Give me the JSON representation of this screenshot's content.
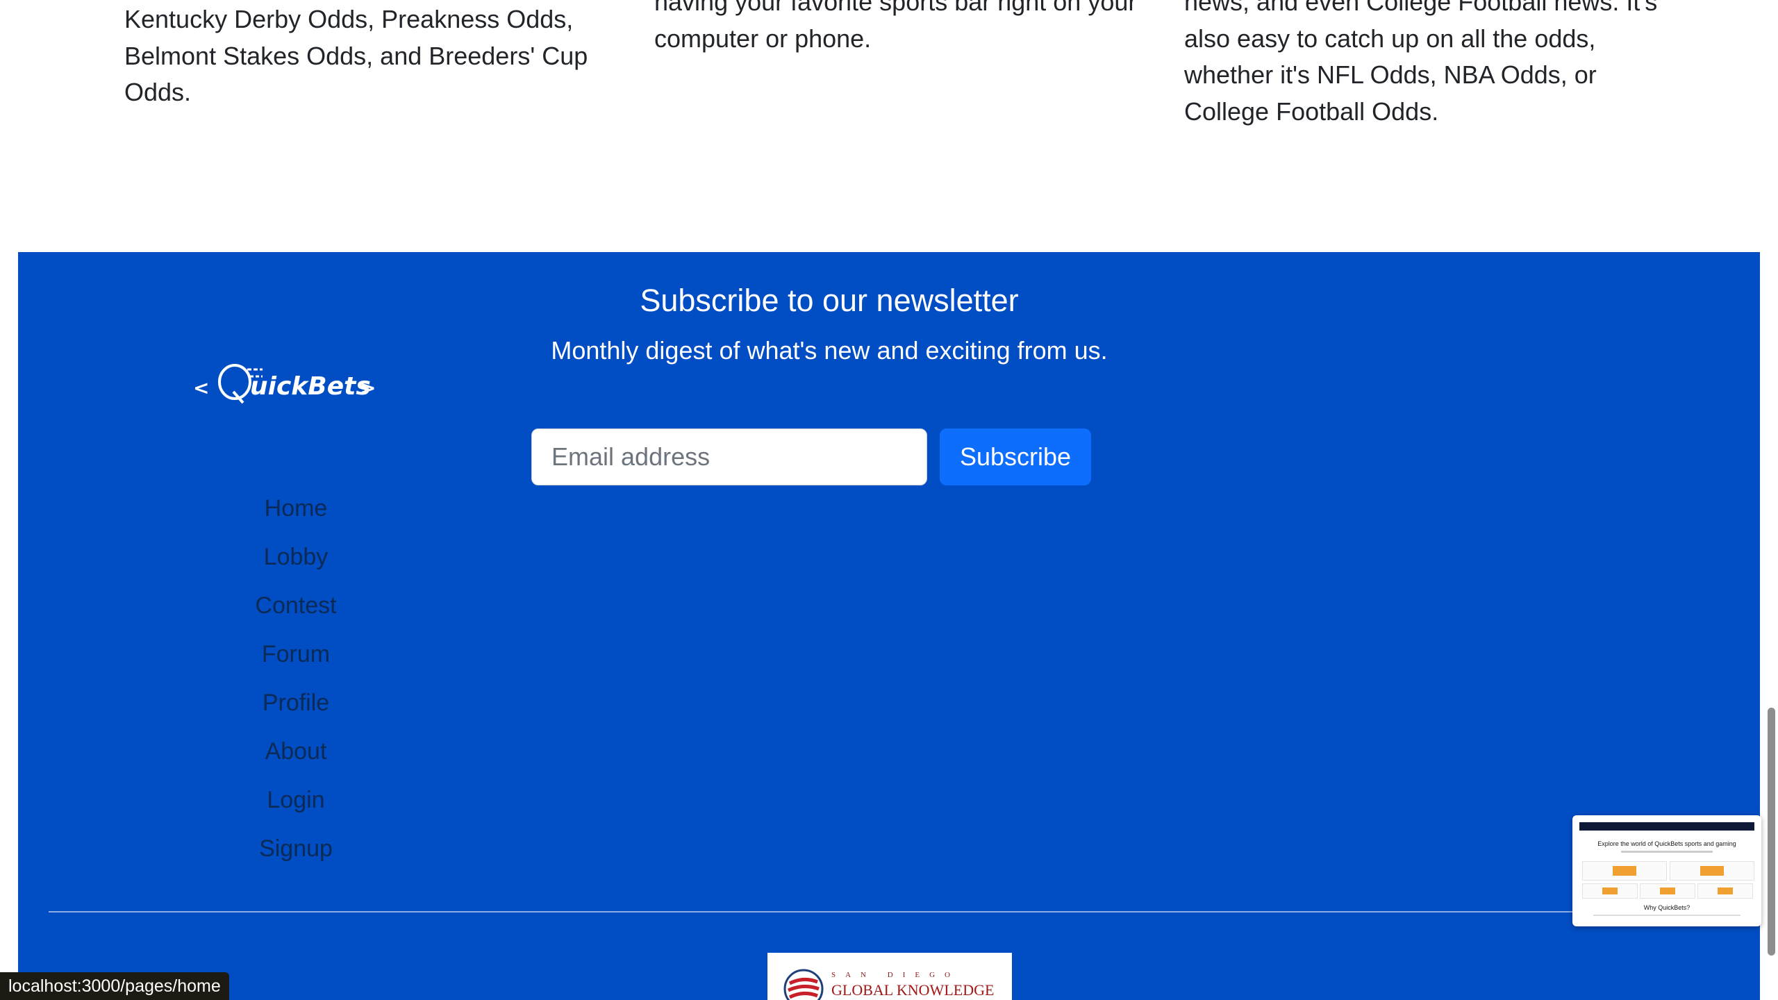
{
  "intro_columns": [
    "Kentucky Derby Odds, Preakness Odds, Belmont Stakes Odds, and Breeders' Cup Odds.",
    "having your favorite sports bar right on your computer or phone.",
    "news, and even College Football news. It's also easy to catch up on all the odds, whether it's NFL Odds, NBA Odds, or College Football Odds."
  ],
  "footer": {
    "background": "#004dc4",
    "logo_text": "<QuickBets>",
    "nav": [
      "Home",
      "Lobby",
      "Contest",
      "Forum",
      "Profile",
      "About",
      "Login",
      "Signup"
    ],
    "newsletter": {
      "title": "Subscribe to our newsletter",
      "subtitle": "Monthly digest of what's new and exciting from us.",
      "email_placeholder": "Email address",
      "button_label": "Subscribe",
      "button_color": "#0d6efd"
    },
    "partner_logo": {
      "line1": "SAN DIEGO",
      "line2": "GLOBAL KNOWLEDGE"
    }
  },
  "preview_thumbnail": {
    "title": "Explore the world of QuickBets sports and gaming",
    "heading": "Why QuickBets?"
  },
  "status_bar": {
    "url": "localhost:3000/pages/home"
  }
}
